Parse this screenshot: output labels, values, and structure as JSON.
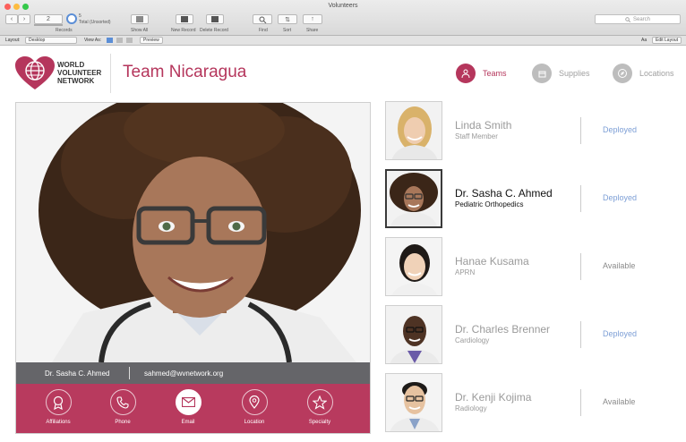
{
  "window": {
    "title": "Volunteers"
  },
  "toolbar": {
    "record_number": "2",
    "record_total": "5",
    "record_status": "Total (Unsorted)",
    "records_label": "Records",
    "show_all_label": "Show All",
    "new_record_label": "New Record",
    "delete_record_label": "Delete Record",
    "find_label": "Find",
    "sort_label": "Sort",
    "share_label": "Share",
    "search_placeholder": "Search"
  },
  "layout_bar": {
    "layout_label": "Layout:",
    "layout_value": "Desktop",
    "view_as_label": "View As:",
    "preview_label": "Preview",
    "edit_layout_label": "Edit Layout",
    "text_size_label": "Aa"
  },
  "header": {
    "logo_text": "WORLD\nVOLUNTEER\nNETWORK",
    "team_title": "Team Nicaragua",
    "nav": [
      {
        "label": "Teams",
        "icon": "people-icon",
        "active": true
      },
      {
        "label": "Supplies",
        "icon": "box-icon",
        "active": false
      },
      {
        "label": "Locations",
        "icon": "compass-icon",
        "active": false
      }
    ]
  },
  "selected": {
    "name": "Dr. Sasha C. Ahmed",
    "email": "sahmed@wvnetwork.org"
  },
  "actions": [
    {
      "label": "Affiliations",
      "icon": "badge-icon",
      "active": false
    },
    {
      "label": "Phone",
      "icon": "phone-icon",
      "active": false
    },
    {
      "label": "Email",
      "icon": "envelope-icon",
      "active": true
    },
    {
      "label": "Location",
      "icon": "map-pin-icon",
      "active": false
    },
    {
      "label": "Specialty",
      "icon": "star-icon",
      "active": false
    }
  ],
  "members": [
    {
      "name": "Linda Smith",
      "role": "Staff Member",
      "status": "Deployed"
    },
    {
      "name": "Dr. Sasha C. Ahmed",
      "role": "Pediatric Orthopedics",
      "status": "Deployed"
    },
    {
      "name": "Hanae Kusama",
      "role": "APRN",
      "status": "Available"
    },
    {
      "name": "Dr. Charles Brenner",
      "role": "Cardiology",
      "status": "Deployed"
    },
    {
      "name": "Dr. Kenji Kojima",
      "role": "Radiology",
      "status": "Available"
    }
  ],
  "colors": {
    "brand": "#b5365c",
    "deployed": "#7d9fd6",
    "available": "#8a8a8a"
  }
}
